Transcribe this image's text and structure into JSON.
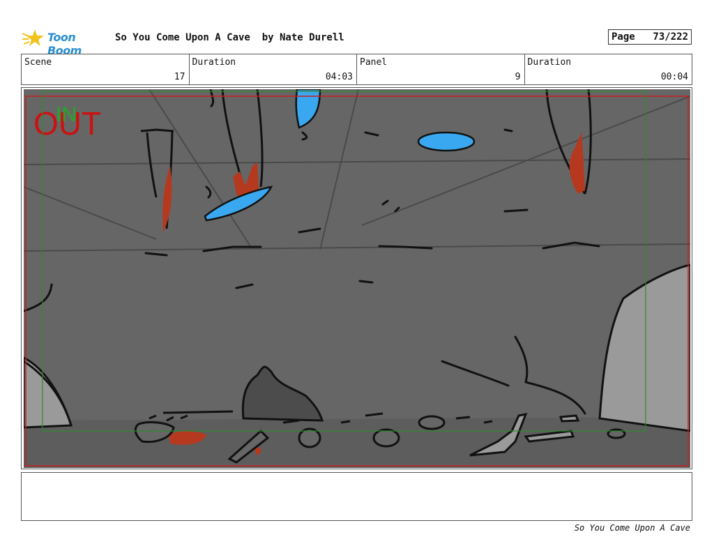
{
  "header": {
    "brand": "Toon Boom",
    "title": "So You Come Upon A Cave  by Nate Durell",
    "page_label": "Page",
    "page_value": "73/222"
  },
  "info": {
    "scene_label": "Scene",
    "scene_value": "17",
    "duration_label": "Duration",
    "duration_value": "04:03",
    "panel_label": "Panel",
    "panel_value": "9",
    "panel_duration_label": "Duration",
    "panel_duration_value": "00:04"
  },
  "panel": {
    "in_marker": "IN",
    "out_marker": "OUT",
    "colors": {
      "cave_fill": "#666666",
      "rock_light": "#9a9a9a",
      "water_blue": "#3aa8f0",
      "blood_red": "#b5391e",
      "out_red": "#cc1111",
      "in_green": "#22aa22"
    }
  },
  "footer": {
    "text": "So You Come Upon A Cave"
  }
}
